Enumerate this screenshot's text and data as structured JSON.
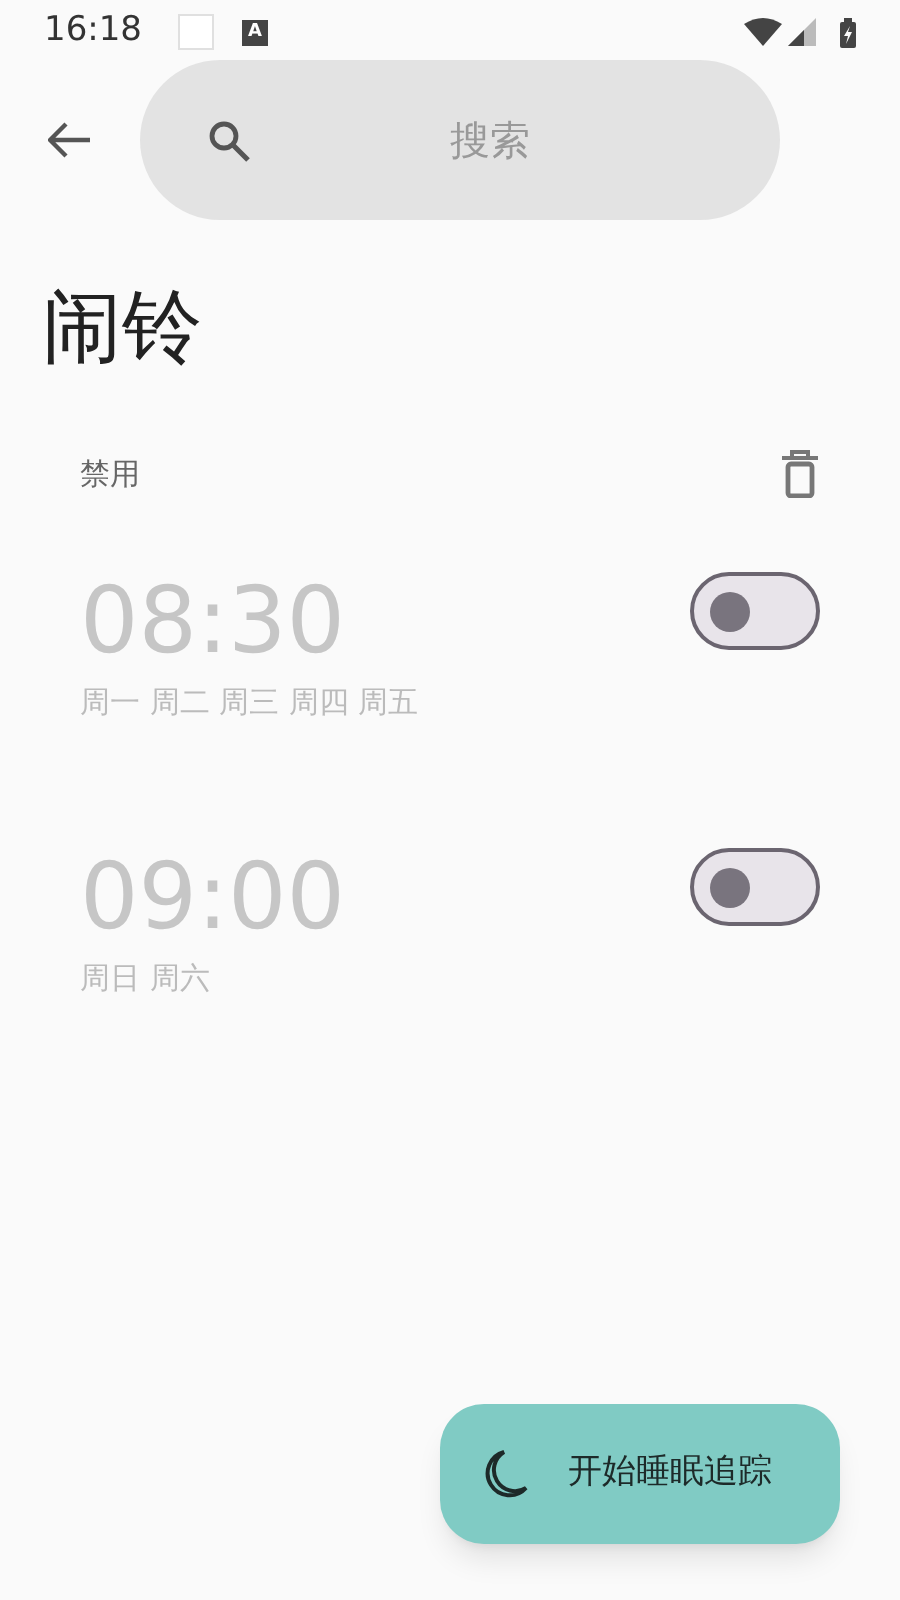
{
  "status_bar": {
    "time": "16:18",
    "app_badge": "A"
  },
  "search": {
    "placeholder": "搜索"
  },
  "title": "闹铃",
  "section": {
    "label": "禁用"
  },
  "alarms": [
    {
      "time": "08:30",
      "days": "周一 周二 周三 周四 周五",
      "on": false
    },
    {
      "time": "09:00",
      "days": "周日 周六",
      "on": false
    }
  ],
  "fab": {
    "label": "开始睡眠追踪"
  }
}
